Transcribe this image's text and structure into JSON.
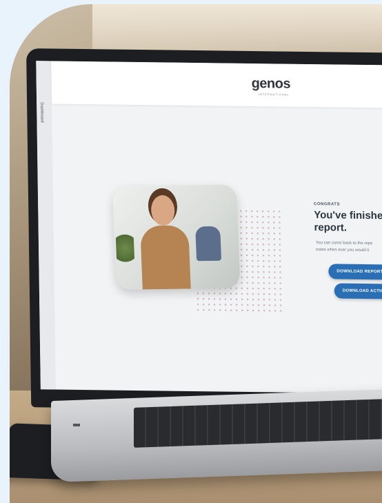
{
  "app": {
    "logo": "genos",
    "logo_sub": "INTERNATIONAL"
  },
  "sidebar": {
    "label": "Dashboard"
  },
  "main": {
    "eyebrow": "CONGRATS",
    "headline_line1": "You've finished rea",
    "headline_line2": "report.",
    "body_line1": "You can come back to the repo",
    "body_line2": "notes when ever you would li"
  },
  "buttons": {
    "download_report": "DOWNLOAD REPORT",
    "download_action_plan": "DOWNLOAD ACTION PLAN"
  },
  "colors": {
    "background": "#e8f3fb",
    "button": "#2a6fb6",
    "screen": "#f1f3f5"
  }
}
